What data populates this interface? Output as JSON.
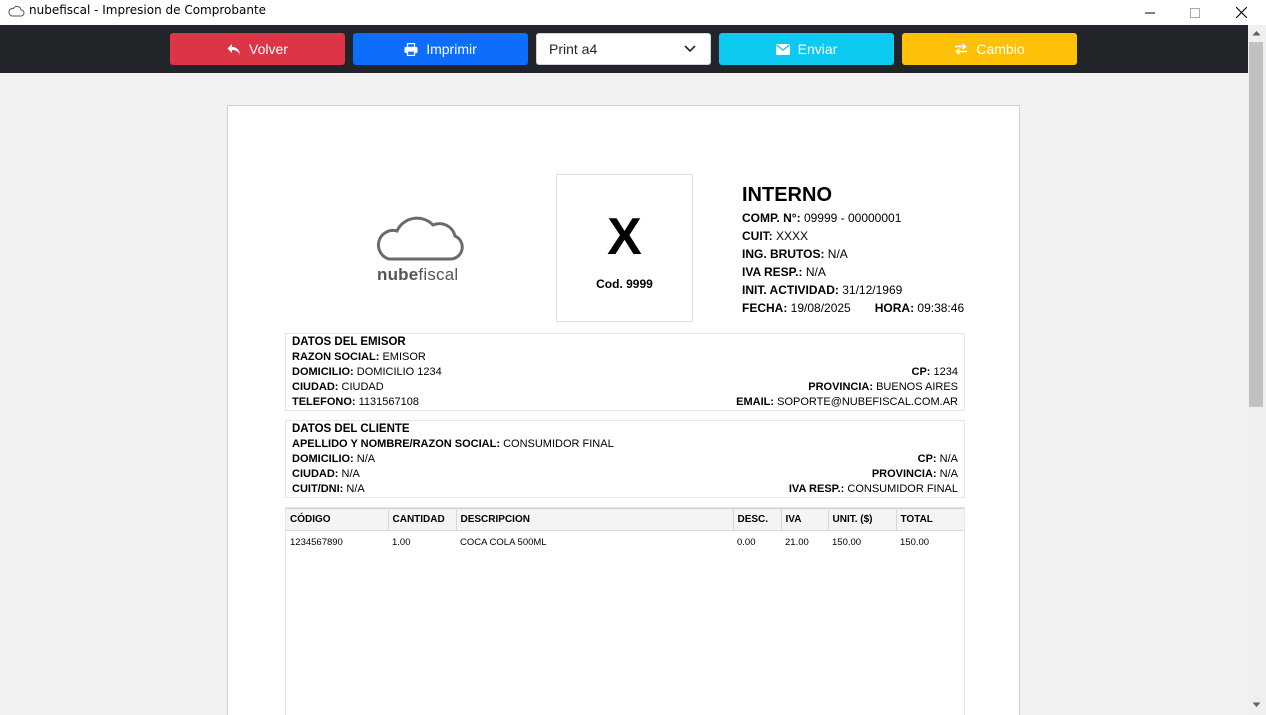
{
  "window": {
    "title": "nubefiscal - Impresion de Comprobante",
    "icon": "cloud-icon"
  },
  "toolbar": {
    "volver_label": "Volver",
    "imprimir_label": "Imprimir",
    "format_select_value": "Print a4",
    "enviar_label": "Enviar",
    "cambio_label": "Cambio",
    "colors": {
      "volver": "#dc3545",
      "imprimir": "#0d6efd",
      "enviar": "#0dcaf0",
      "cambio": "#ffc107",
      "toolbar_bg": "#212529"
    }
  },
  "document": {
    "logo": {
      "brand_bold": "nube",
      "brand_light": "fiscal"
    },
    "type_box": {
      "letter": "X",
      "code": "Cod. 9999"
    },
    "header": {
      "title": "INTERNO",
      "comp_label": "COMP. N°:",
      "comp_value": "09999 - 00000001",
      "cuit_label": "CUIT:",
      "cuit_value": "XXXX",
      "ing_brutos_label": "ING. BRUTOS:",
      "ing_brutos_value": "N/A",
      "iva_resp_label": "IVA RESP.:",
      "iva_resp_value": "N/A",
      "init_actividad_label": "INIT. ACTIVIDAD:",
      "init_actividad_value": "31/12/1969",
      "fecha_label": "FECHA:",
      "fecha_value": "19/08/2025",
      "hora_label": "HORA:",
      "hora_value": "09:38:46"
    },
    "emisor": {
      "title": "DATOS DEL EMISOR",
      "razon_social_label": "RAZON SOCIAL:",
      "razon_social_value": "EMISOR",
      "domicilio_label": "DOMICILIO:",
      "domicilio_value": "DOMICILIO 1234",
      "cp_label": "CP:",
      "cp_value": "1234",
      "ciudad_label": "CIUDAD:",
      "ciudad_value": "CIUDAD",
      "provincia_label": "PROVINCIA:",
      "provincia_value": "BUENOS AIRES",
      "telefono_label": "TELEFONO:",
      "telefono_value": "1131567108",
      "email_label": "EMAIL:",
      "email_value": "SOPORTE@NUBEFISCAL.COM.AR"
    },
    "cliente": {
      "title": "DATOS DEL CLIENTE",
      "nombre_label": "APELLIDO Y NOMBRE/RAZON SOCIAL:",
      "nombre_value": "CONSUMIDOR FINAL",
      "domicilio_label": "DOMICILIO:",
      "domicilio_value": "N/A",
      "cp_label": "CP:",
      "cp_value": "N/A",
      "ciudad_label": "CIUDAD:",
      "ciudad_value": "N/A",
      "provincia_label": "PROVINCIA:",
      "provincia_value": "N/A",
      "cuit_label": "CUIT/DNI:",
      "cuit_value": "N/A",
      "iva_resp_label": "IVA RESP.:",
      "iva_resp_value": "CONSUMIDOR FINAL"
    },
    "items": {
      "columns": [
        "CÓDIGO",
        "CANTIDAD",
        "DESCRIPCION",
        "DESC.",
        "IVA",
        "UNIT. ($)",
        "TOTAL"
      ],
      "rows": [
        [
          "1234567890",
          "1.00",
          "COCA COLA 500ML",
          "0.00",
          "21.00",
          "150.00",
          "150.00"
        ]
      ]
    }
  }
}
